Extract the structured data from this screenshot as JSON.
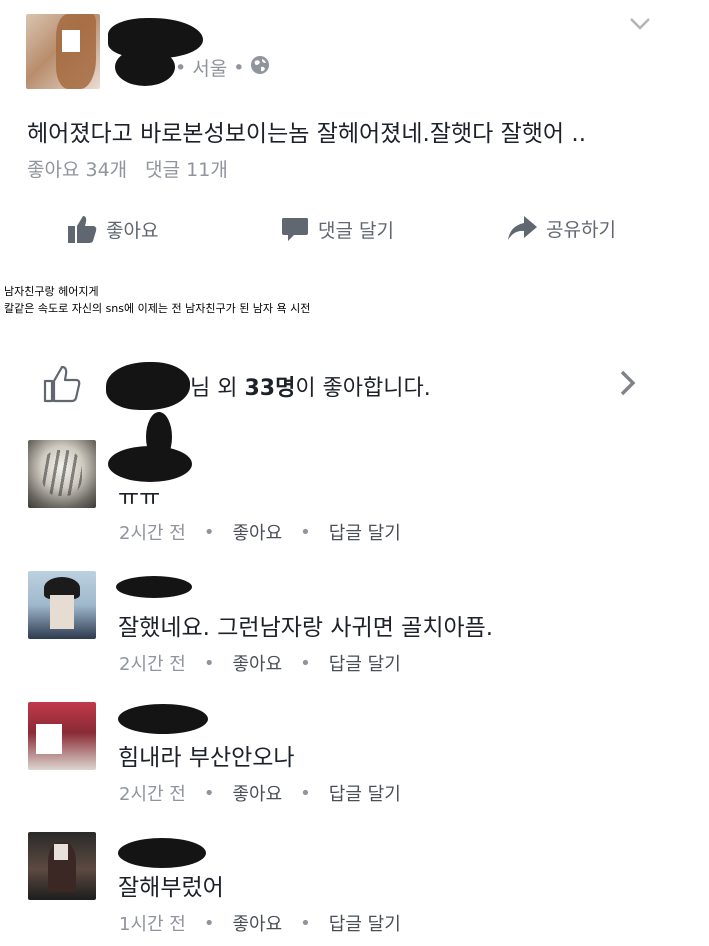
{
  "post": {
    "location": "서울",
    "text": "헤어졌다고 바로본성보이는놈 잘헤어졌네.잘햇다 잘햇어 ..",
    "likes_label": "좋아요 34개",
    "comments_label": "댓글 11개",
    "actions": {
      "like": "좋아요",
      "comment": "댓글 달기",
      "share": "공유하기"
    }
  },
  "caption": {
    "line1": "남자친구랑 헤어지게",
    "line2": "칼같은 속도로 자신의 sns에 이제는 전 남자친구가 된 남자 욕 시전"
  },
  "likes_bar": {
    "pre": "님 외 ",
    "count": "33명",
    "post": "이 좋아합니다."
  },
  "comments": [
    {
      "text": "ㅠㅠ",
      "time": "2시간 전",
      "like": "좋아요",
      "reply": "답글 달기"
    },
    {
      "text": "잘했네요. 그런남자랑 사귀면 골치아픔.",
      "time": "2시간 전",
      "like": "좋아요",
      "reply": "답글 달기"
    },
    {
      "text": "힘내라 부산안오나",
      "time": "2시간 전",
      "like": "좋아요",
      "reply": "답글 달기"
    },
    {
      "text": "잘해부렀어",
      "time": "1시간 전",
      "like": "좋아요",
      "reply": "답글 달기"
    }
  ]
}
